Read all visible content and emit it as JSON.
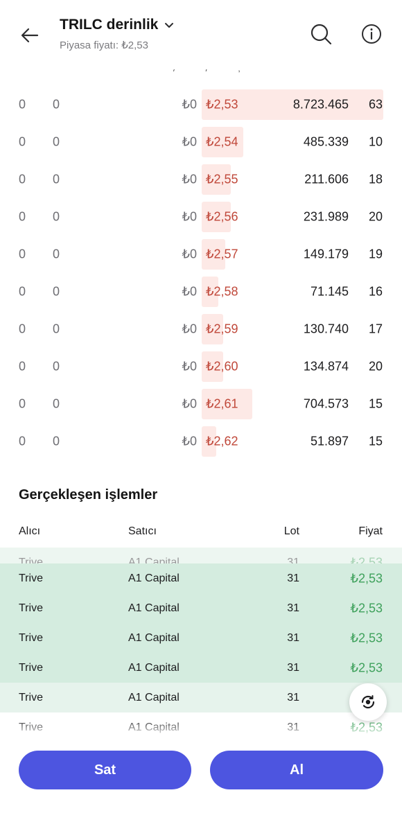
{
  "header": {
    "title": "TRILC derinlik",
    "subtitle": "Piyasa fiyatı: ₺2,53",
    "cut_text": "/ / ,"
  },
  "depth": {
    "rows": [
      {
        "a": "0",
        "b": "0",
        "bid_price": "₺0",
        "ask_price": "₺2,53",
        "volume": "8.723.465",
        "orders": "63",
        "level": 1.0
      },
      {
        "a": "0",
        "b": "0",
        "bid_price": "₺0",
        "ask_price": "₺2,54",
        "volume": "485.339",
        "orders": "10",
        "level": 0.23
      },
      {
        "a": "0",
        "b": "0",
        "bid_price": "₺0",
        "ask_price": "₺2,55",
        "volume": "211.606",
        "orders": "18",
        "level": 0.16
      },
      {
        "a": "0",
        "b": "0",
        "bid_price": "₺0",
        "ask_price": "₺2,56",
        "volume": "231.989",
        "orders": "20",
        "level": 0.16
      },
      {
        "a": "0",
        "b": "0",
        "bid_price": "₺0",
        "ask_price": "₺2,57",
        "volume": "149.179",
        "orders": "19",
        "level": 0.13
      },
      {
        "a": "0",
        "b": "0",
        "bid_price": "₺0",
        "ask_price": "₺2,58",
        "volume": "71.145",
        "orders": "16",
        "level": 0.09
      },
      {
        "a": "0",
        "b": "0",
        "bid_price": "₺0",
        "ask_price": "₺2,59",
        "volume": "130.740",
        "orders": "17",
        "level": 0.12
      },
      {
        "a": "0",
        "b": "0",
        "bid_price": "₺0",
        "ask_price": "₺2,60",
        "volume": "134.874",
        "orders": "20",
        "level": 0.12
      },
      {
        "a": "0",
        "b": "0",
        "bid_price": "₺0",
        "ask_price": "₺2,61",
        "volume": "704.573",
        "orders": "15",
        "level": 0.28
      },
      {
        "a": "0",
        "b": "0",
        "bid_price": "₺0",
        "ask_price": "₺2,62",
        "volume": "51.897",
        "orders": "15",
        "level": 0.08
      }
    ]
  },
  "trades": {
    "title": "Gerçekleşen işlemler",
    "headers": {
      "buyer": "Alıcı",
      "seller": "Satıcı",
      "lot": "Lot",
      "price": "Fiyat"
    },
    "rows": [
      {
        "buyer": "Trive",
        "seller": "A1 Capital",
        "lot": "31",
        "price": "₺2,53"
      },
      {
        "buyer": "Trive",
        "seller": "A1 Capital",
        "lot": "31",
        "price": "₺2,53"
      },
      {
        "buyer": "Trive",
        "seller": "A1 Capital",
        "lot": "31",
        "price": "₺2,53"
      },
      {
        "buyer": "Trive",
        "seller": "A1 Capital",
        "lot": "31",
        "price": "₺2,53"
      },
      {
        "buyer": "Trive",
        "seller": "A1 Capital",
        "lot": "31",
        "price": "₺2,53"
      },
      {
        "buyer": "Trive",
        "seller": "A1 Capital",
        "lot": "31",
        "price": "₺2,53"
      },
      {
        "buyer": "Trive",
        "seller": "A1 Capital",
        "lot": "31",
        "price": "₺2,53"
      }
    ]
  },
  "actions": {
    "sell_label": "Sat",
    "buy_label": "Al"
  },
  "colors": {
    "ask_red": "#c0483a",
    "ask_bar": "#fde9e6",
    "trade_green": "#3fa15c",
    "trade_highlight": "#d4ecdf",
    "button_blue": "#4d55e0"
  }
}
